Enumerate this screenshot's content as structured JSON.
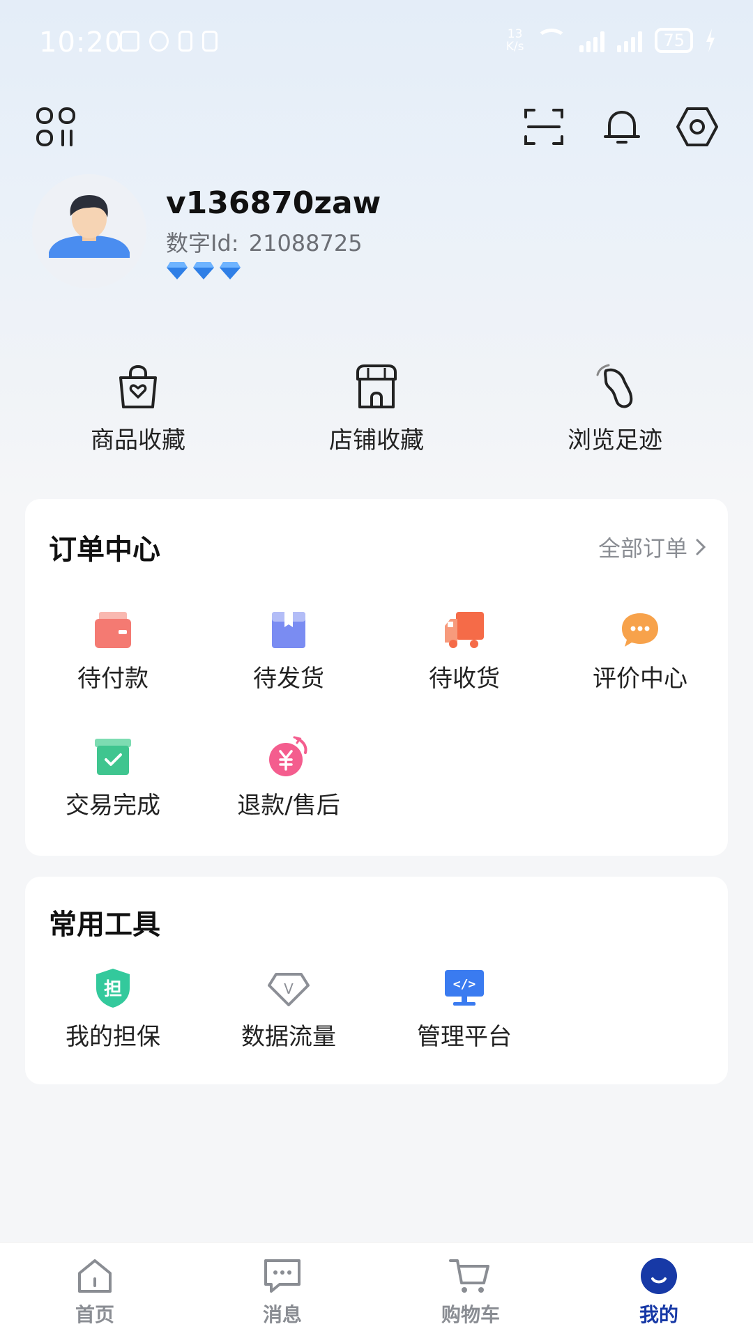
{
  "status_bar": {
    "time": "10:20",
    "net_speed_value": "13",
    "net_speed_unit": "K/s",
    "battery": "75"
  },
  "profile": {
    "username": "v136870zaw",
    "id_label": "数字Id:",
    "id_value": "21088725",
    "gem_count": 3
  },
  "shortcuts": [
    {
      "label": "商品收藏",
      "icon": "bag-heart-icon"
    },
    {
      "label": "店铺收藏",
      "icon": "store-icon"
    },
    {
      "label": "浏览足迹",
      "icon": "footprint-icon"
    }
  ],
  "orders": {
    "title": "订单中心",
    "all_link": "全部订单",
    "items": [
      {
        "label": "待付款",
        "icon": "wallet-icon",
        "color": "#f47a72"
      },
      {
        "label": "待发货",
        "icon": "package-icon",
        "color": "#7a8cf2"
      },
      {
        "label": "待收货",
        "icon": "truck-icon",
        "color": "#f56b48"
      },
      {
        "label": "评价中心",
        "icon": "chat-bubble-icon",
        "color": "#f7a24b"
      },
      {
        "label": "交易完成",
        "icon": "check-box-icon",
        "color": "#3fc58f"
      },
      {
        "label": "退款/售后",
        "icon": "refund-icon",
        "color": "#f45d8e"
      }
    ]
  },
  "tools": {
    "title": "常用工具",
    "items": [
      {
        "label": "我的担保",
        "icon": "guarantee-shield-icon",
        "glyph": "担",
        "color": "#33c99c"
      },
      {
        "label": "数据流量",
        "icon": "diamond-v-icon",
        "glyph": "V",
        "color": "#8c8f96"
      },
      {
        "label": "管理平台",
        "icon": "code-monitor-icon",
        "glyph": "</>",
        "color": "#3a7bf0"
      }
    ]
  },
  "nav": [
    {
      "label": "首页",
      "icon": "home-icon"
    },
    {
      "label": "消息",
      "icon": "message-icon"
    },
    {
      "label": "购物车",
      "icon": "cart-icon"
    },
    {
      "label": "我的",
      "icon": "profile-face-icon",
      "active": true,
      "color": "#1739a6"
    }
  ]
}
